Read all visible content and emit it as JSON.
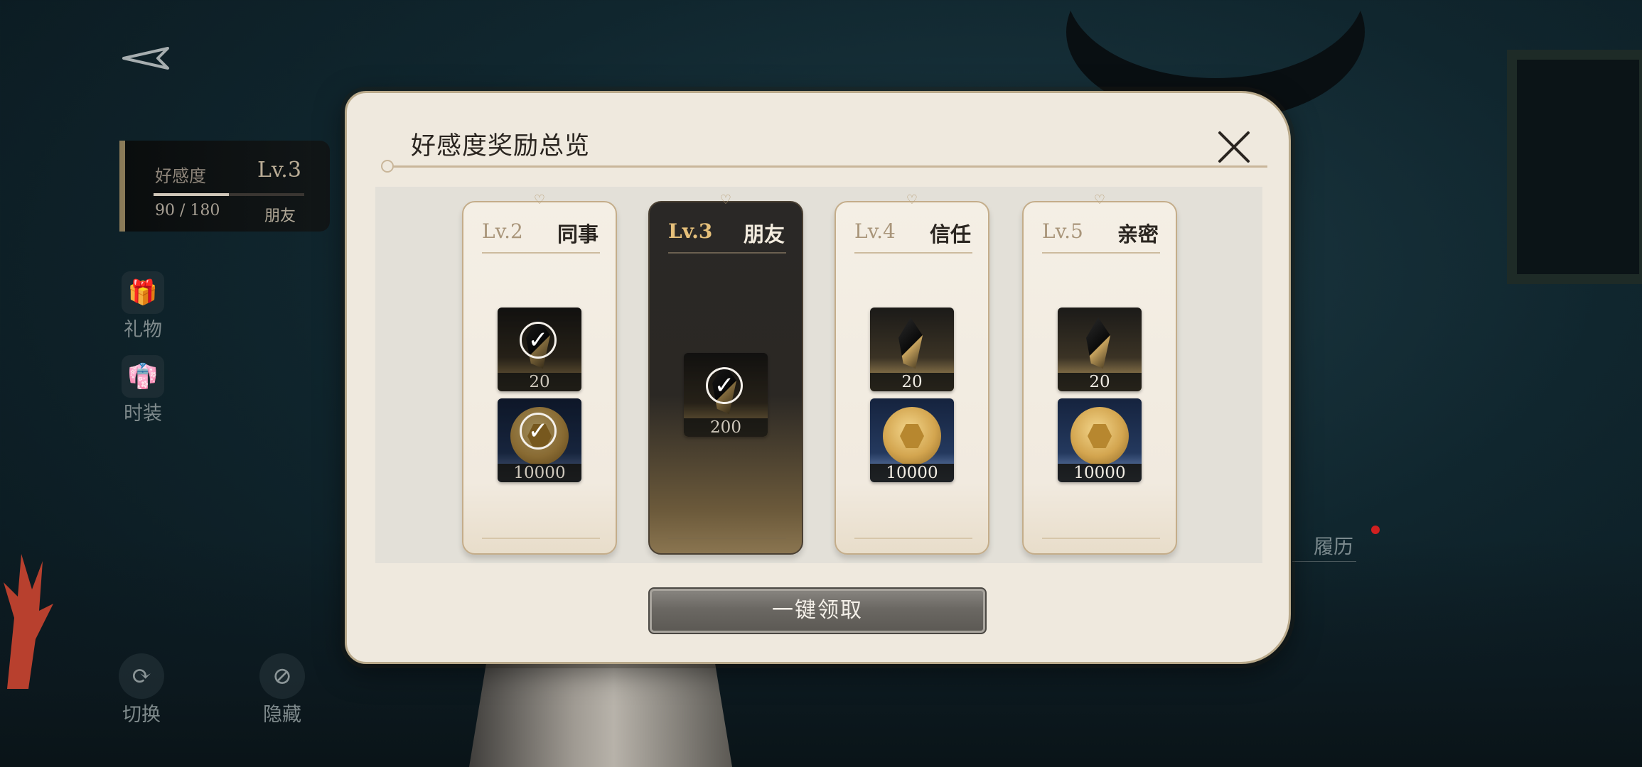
{
  "hud": {
    "affinity_label": "好感度",
    "level": "Lv.3",
    "progress_current": "90",
    "progress_sep": "/",
    "progress_max": "180",
    "progress_fraction": 0.5,
    "rank": "朋友",
    "gift_label": "礼物",
    "outfit_label": "时装",
    "switch_label": "切换",
    "hide_label": "隐藏",
    "resume_label": "履历"
  },
  "dialog": {
    "title": "好感度奖励总览",
    "claim_all_label": "一键领取",
    "cards": [
      {
        "level": "Lv.2",
        "name": "同事",
        "current": false,
        "rewards": [
          {
            "type": "crystal",
            "qty": "20",
            "claimed": true
          },
          {
            "type": "coin",
            "qty": "10000",
            "claimed": true
          }
        ]
      },
      {
        "level": "Lv.3",
        "name": "朋友",
        "current": true,
        "rewards": [
          {
            "type": "crystal",
            "qty": "200",
            "claimed": true
          }
        ]
      },
      {
        "level": "Lv.4",
        "name": "信任",
        "current": false,
        "rewards": [
          {
            "type": "crystal",
            "qty": "20",
            "claimed": false
          },
          {
            "type": "coin",
            "qty": "10000",
            "claimed": false
          }
        ]
      },
      {
        "level": "Lv.5",
        "name": "亲密",
        "current": false,
        "rewards": [
          {
            "type": "crystal",
            "qty": "20",
            "claimed": false
          },
          {
            "type": "coin",
            "qty": "10000",
            "claimed": false
          }
        ]
      }
    ]
  },
  "icons": {
    "back": "back-arrow-icon",
    "close": "close-icon",
    "gift": "gift-icon",
    "outfit": "outfit-icon",
    "switch": "switch-icon",
    "hide": "hide-icon",
    "claimed": "check-icon"
  },
  "colors": {
    "accent_gold": "#e6c07a",
    "dialog_bg": "#efe9de",
    "current_card_bg": "#2a2826",
    "resume_dot": "#d02020"
  }
}
